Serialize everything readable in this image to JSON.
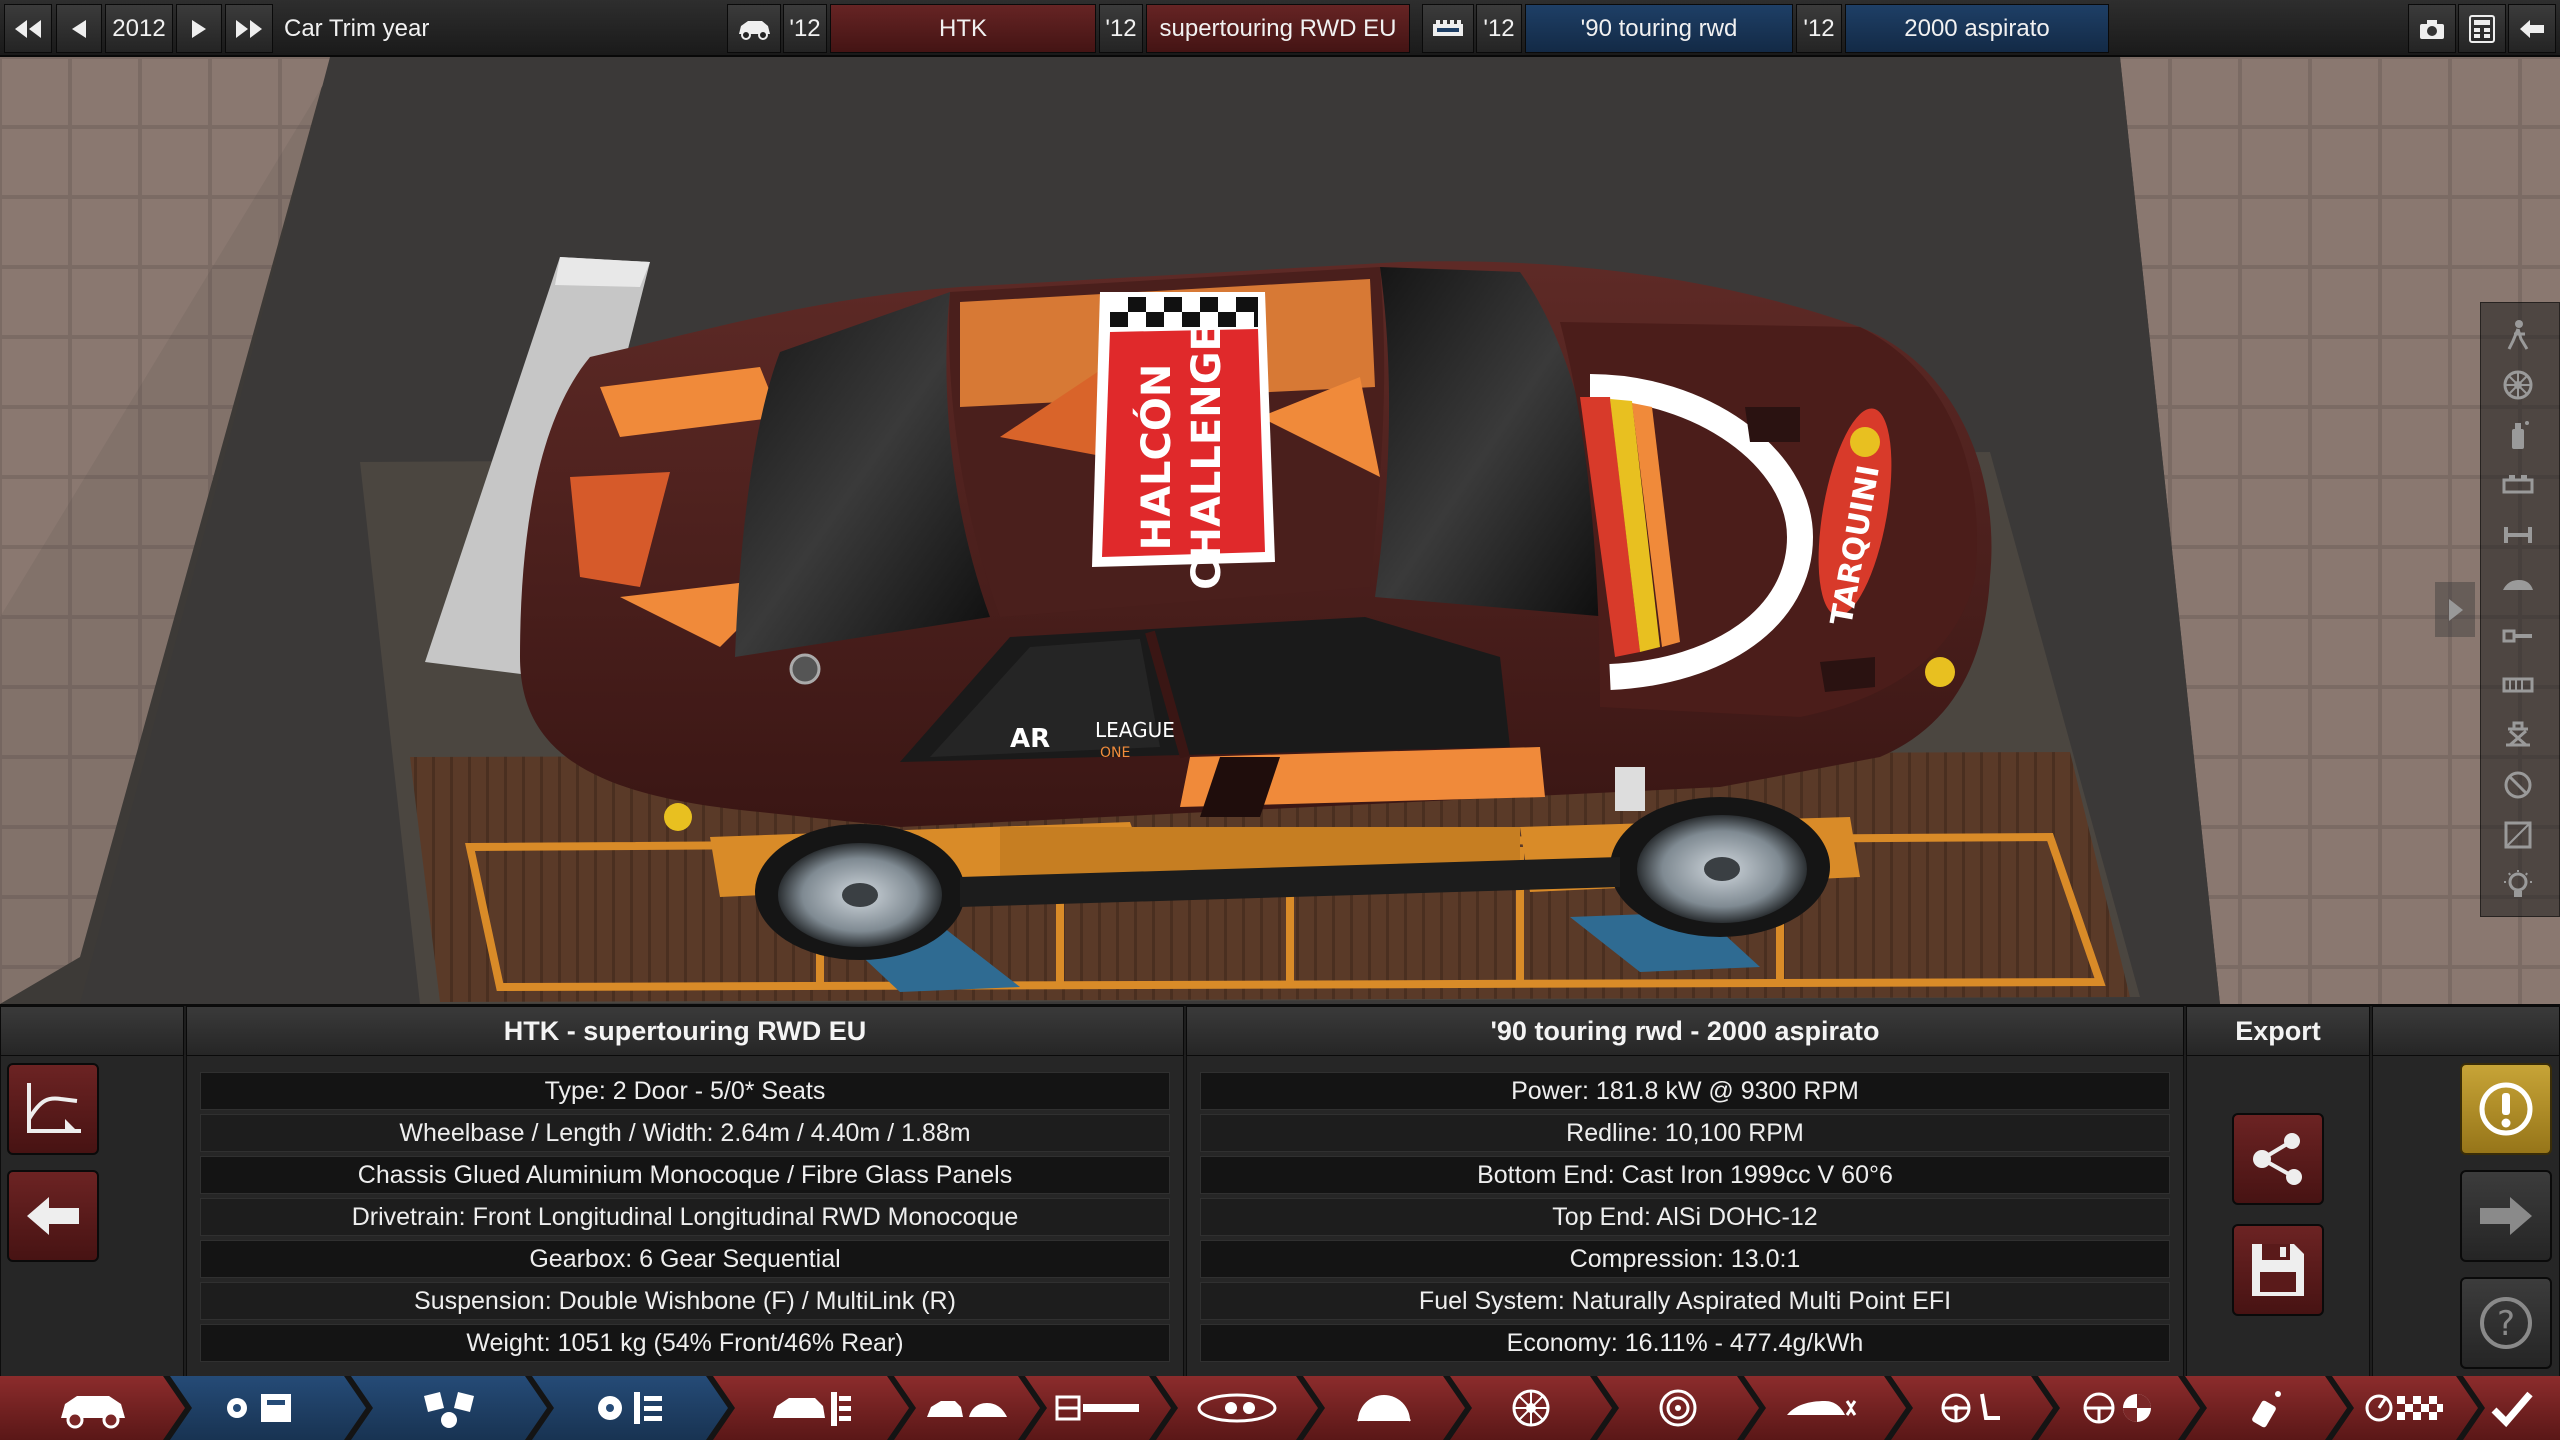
{
  "topbar": {
    "year_value": "2012",
    "car_trim_year_label": "Car Trim year",
    "model_year": "'12",
    "model_name": "HTK",
    "trim_year": "'12",
    "trim_name": "supertouring RWD EU",
    "engine_family_year": "'12",
    "engine_family_name": "'90 touring rwd",
    "engine_variant_year": "'12",
    "engine_variant_name": "2000 aspirato",
    "icons": {
      "first": "fast-rewind-icon",
      "prev": "step-back-icon",
      "next": "step-forward-icon",
      "last": "fast-forward-icon",
      "car": "car-icon",
      "engine": "engine-icon",
      "camera": "camera-icon",
      "calculator": "calculator-icon",
      "back": "back-arrow-icon"
    }
  },
  "car_livery": {
    "roof_text_line1": "HALCÓN",
    "roof_text_line2": "CHALLENGE",
    "hood_text": "TARQUINI",
    "door_text_1": "LEAGUE",
    "door_text_2": "ONE",
    "door_logo": "AR"
  },
  "car_panel": {
    "title": "HTK - supertouring RWD EU",
    "rows": [
      "Type: 2 Door - 5/0* Seats",
      "Wheelbase / Length / Width: 2.64m / 4.40m / 1.88m",
      "Chassis Glued Aluminium Monocoque / Fibre Glass Panels",
      "Drivetrain: Front Longitudinal Longitudinal RWD Monocoque",
      "Gearbox: 6 Gear Sequential",
      "Suspension: Double Wishbone (F) / MultiLink (R)",
      "Weight: 1051 kg (54% Front/46% Rear)"
    ]
  },
  "engine_panel": {
    "title": "'90 touring rwd - 2000 aspirato",
    "rows": [
      "Power: 181.8 kW @ 9300 RPM",
      "Redline:  10,100 RPM",
      "Bottom End: Cast Iron 1999cc V 60°6",
      "Top End: AlSi DOHC-12",
      "Compression: 13.0:1",
      "Fuel System: Naturally Aspirated Multi Point EFI",
      "Economy: 16.11% - 477.4g/kWh"
    ]
  },
  "export_panel": {
    "title": "Export"
  },
  "colors": {
    "accent_red": "#7a2626",
    "accent_blue": "#1e3f66",
    "warning_gold": "#c7a437",
    "text": "#e9e9e9"
  },
  "bottom_nav": [
    "car-icon",
    "engine-block-icon",
    "engine-top-icon",
    "engine-tune-icon",
    "car-design-icon",
    "car-body-icon",
    "chassis-icon",
    "headlights-icon",
    "sawblade-icon",
    "wheel-icon",
    "brakes-icon",
    "aero-icon",
    "steering-seat-icon",
    "safety-icon",
    "spray-can-icon",
    "testing-icon",
    "confirm-checkmark-icon"
  ]
}
